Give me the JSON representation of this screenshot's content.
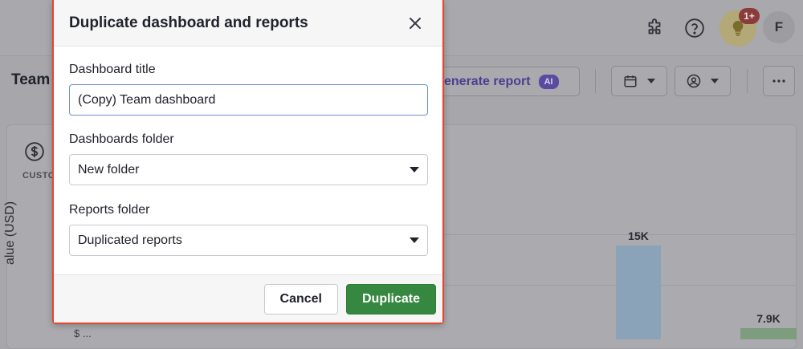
{
  "colors": {
    "modal_border": "#e8452c",
    "primary_button": "#368740",
    "ai_badge": "#5a4aa0",
    "bar_blue": "#8aa3b9",
    "bar_green": "#7e9c7e"
  },
  "topbar": {
    "icons": [
      "puzzle-icon",
      "help-icon",
      "lightbulb-icon"
    ],
    "notification_count": "1+",
    "avatar_initial": "F"
  },
  "toolbar": {
    "page_title": "Team",
    "generate_report_label": "enerate report",
    "ai_badge": "AI",
    "icons": [
      "calendar-icon",
      "user-circle-icon",
      "more-icon"
    ]
  },
  "card": {
    "label": "CUSTO",
    "y_axis_label": "alue (USD)",
    "y_tick": "$ ..."
  },
  "chart_data": {
    "type": "bar",
    "values": [
      15000,
      7900
    ],
    "data_labels": [
      "15K",
      "7.9K"
    ]
  },
  "modal": {
    "title": "Duplicate dashboard and reports",
    "dashboard_title_label": "Dashboard title",
    "dashboard_title_value": "(Copy) Team dashboard",
    "dashboards_folder_label": "Dashboards folder",
    "dashboards_folder_value": "New folder",
    "reports_folder_label": "Reports folder",
    "reports_folder_value": "Duplicated reports",
    "cancel_label": "Cancel",
    "duplicate_label": "Duplicate"
  }
}
